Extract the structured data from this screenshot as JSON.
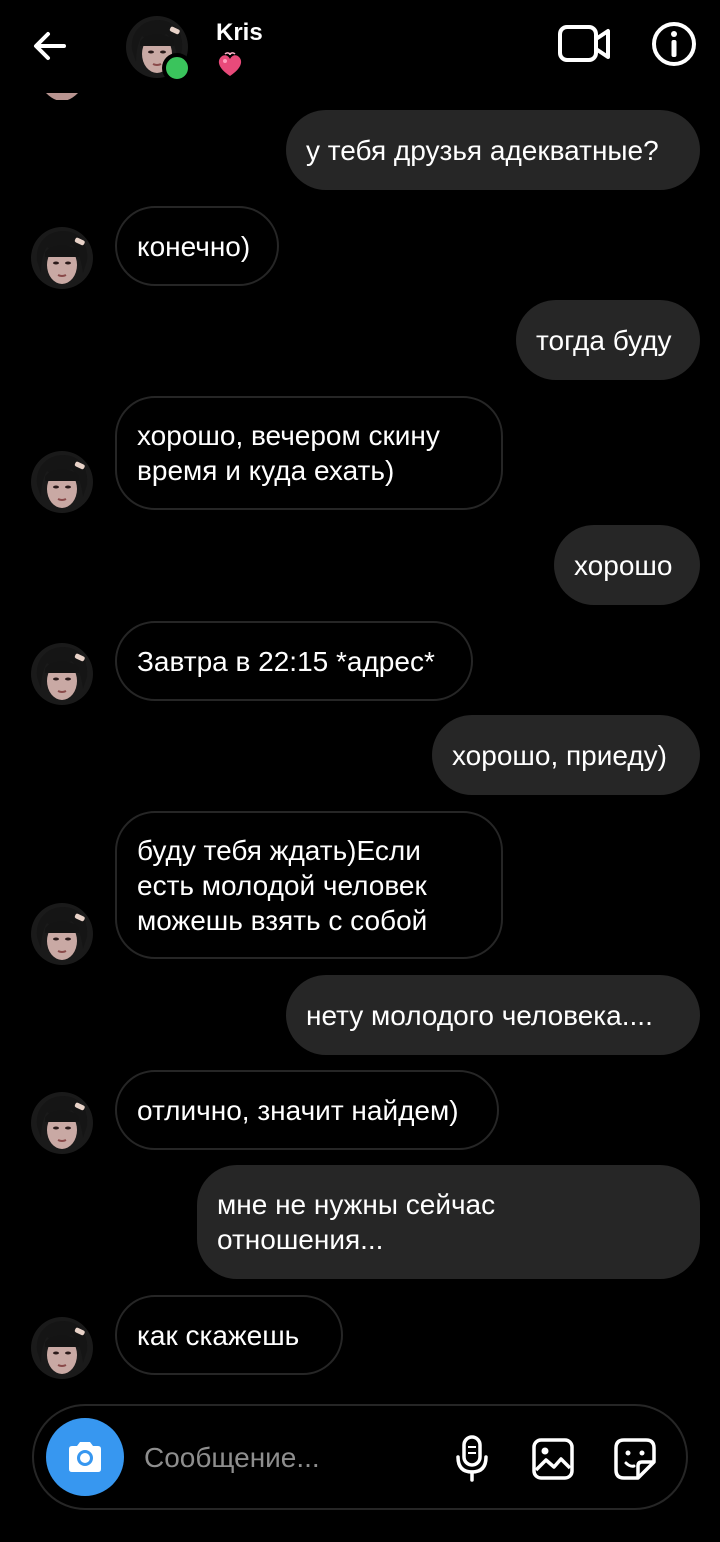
{
  "header": {
    "back_label": "back",
    "contact_name": "Kris",
    "status_icon": "heart-emoji-icon",
    "online": true
  },
  "messages": [
    {
      "side": "out",
      "text": "у тебя друзья адекватные?"
    },
    {
      "side": "in",
      "text": "конечно)"
    },
    {
      "side": "out",
      "text": "тогда буду"
    },
    {
      "side": "in",
      "text": "хорошо, вечером скину\nвремя и куда ехать)"
    },
    {
      "side": "out",
      "text": "хорошо"
    },
    {
      "side": "in",
      "text": "Завтра в 22:15 *адрес*"
    },
    {
      "side": "out",
      "text": "хорошо, приеду)"
    },
    {
      "side": "in",
      "text": "буду тебя ждать)Если\nесть молодой человек\nможешь взять с собой"
    },
    {
      "side": "out",
      "text": "нету молодого человека...."
    },
    {
      "side": "in",
      "text": "отлично, значит найдем)"
    },
    {
      "side": "out",
      "text": "мне не нужны сейчас\nотношения..."
    },
    {
      "side": "in",
      "text": "как скажешь"
    }
  ],
  "composer": {
    "placeholder": "Сообщение..."
  },
  "colors": {
    "background": "#000000",
    "outgoing_bubble": "#262626",
    "incoming_border": "#262626",
    "accent": "#3797f0",
    "online": "#3ac45c"
  },
  "icons": [
    "back-arrow-icon",
    "video-camera-icon",
    "info-icon",
    "camera-icon",
    "microphone-icon",
    "gallery-icon",
    "sticker-icon"
  ]
}
